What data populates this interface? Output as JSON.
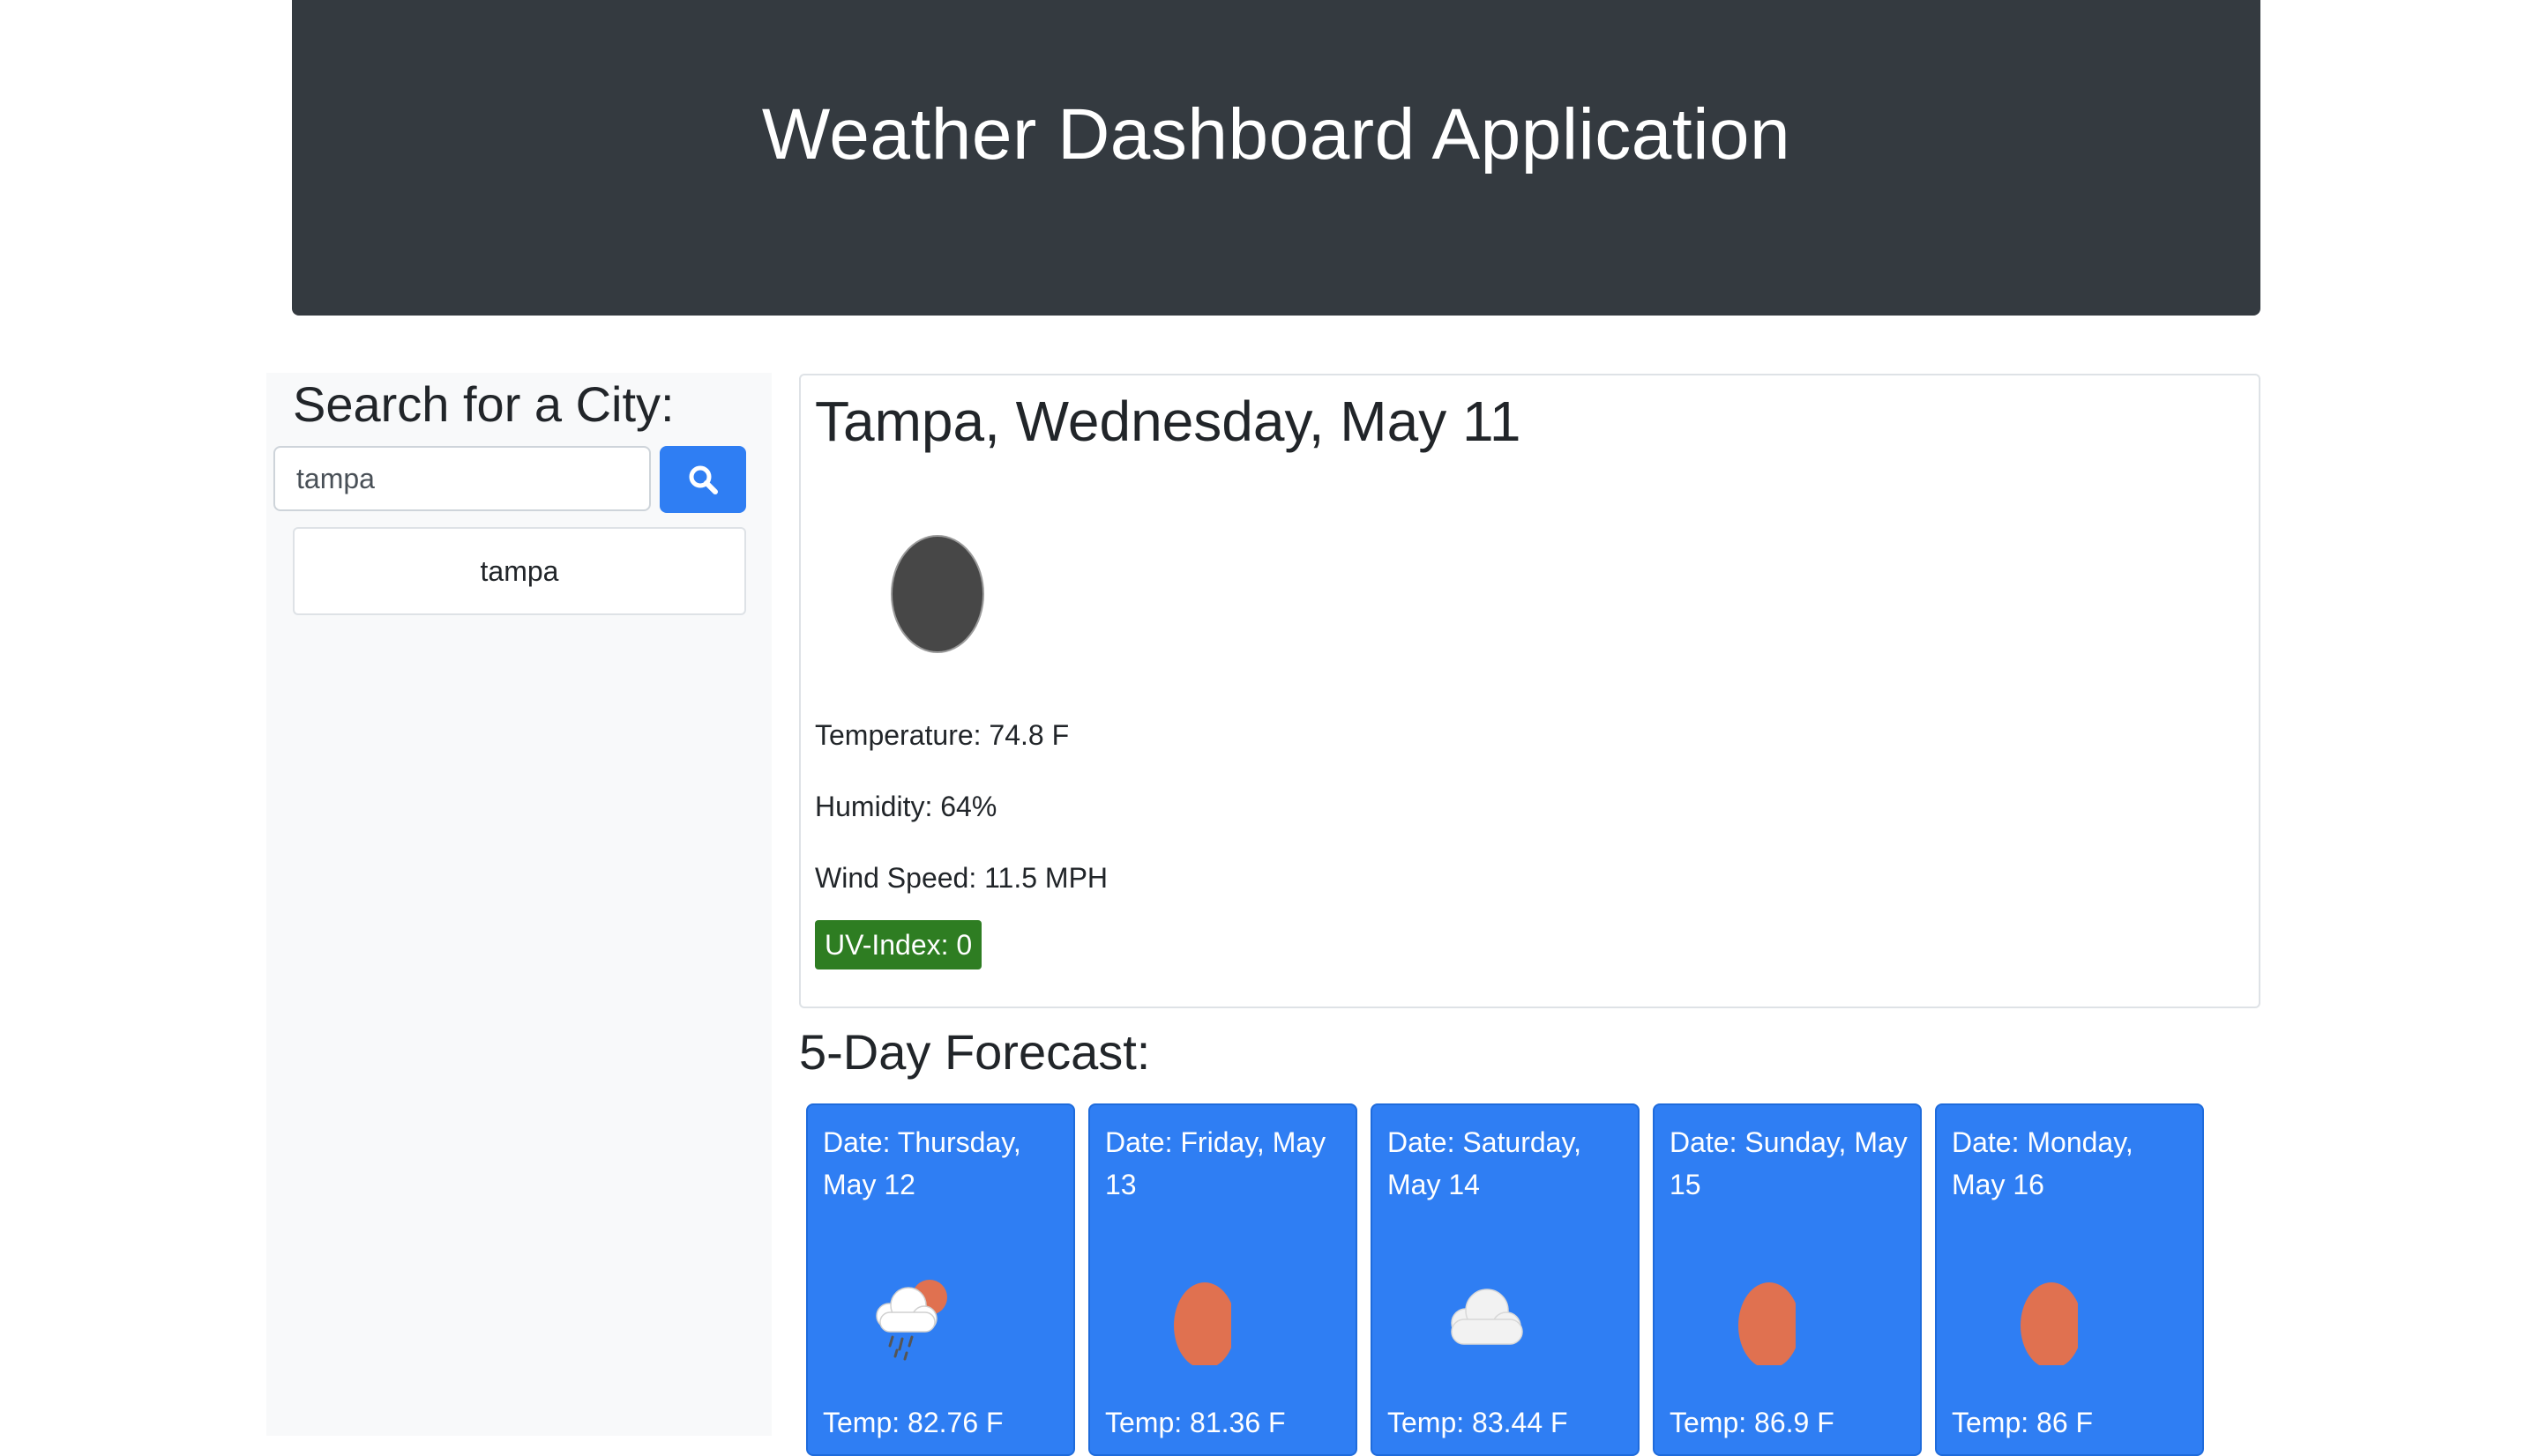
{
  "header": {
    "title": "Weather Dashboard Application"
  },
  "search": {
    "heading": "Search for a City:",
    "input_value": "tampa",
    "button_icon": "search-icon",
    "history": [
      "tampa"
    ]
  },
  "current": {
    "title": "Tampa, Wednesday, May 11",
    "icon": "moon-icon",
    "temperature": "Temperature: 74.8 F",
    "humidity": "Humidity: 64%",
    "wind": "Wind Speed: 11.5 MPH",
    "uv": "UV-Index: 0",
    "uv_color": "#2e7d22"
  },
  "forecast": {
    "heading": "5-Day Forecast:",
    "days": [
      {
        "date": "Date: Thursday, May 12",
        "icon": "sun-cloud-rain-icon",
        "temp": "Temp: 82.76 F"
      },
      {
        "date": "Date: Friday, May 13",
        "icon": "sun-icon",
        "temp": "Temp: 81.36 F"
      },
      {
        "date": "Date: Saturday, May 14",
        "icon": "cloud-icon",
        "temp": "Temp: 83.44 F"
      },
      {
        "date": "Date: Sunday, May 15",
        "icon": "sun-icon",
        "temp": "Temp: 86.9 F"
      },
      {
        "date": "Date: Monday, May 16",
        "icon": "sun-icon",
        "temp": "Temp: 86 F"
      }
    ]
  },
  "colors": {
    "header_bg": "#343a40",
    "primary": "#2f7ef3",
    "sun": "#e07150"
  }
}
